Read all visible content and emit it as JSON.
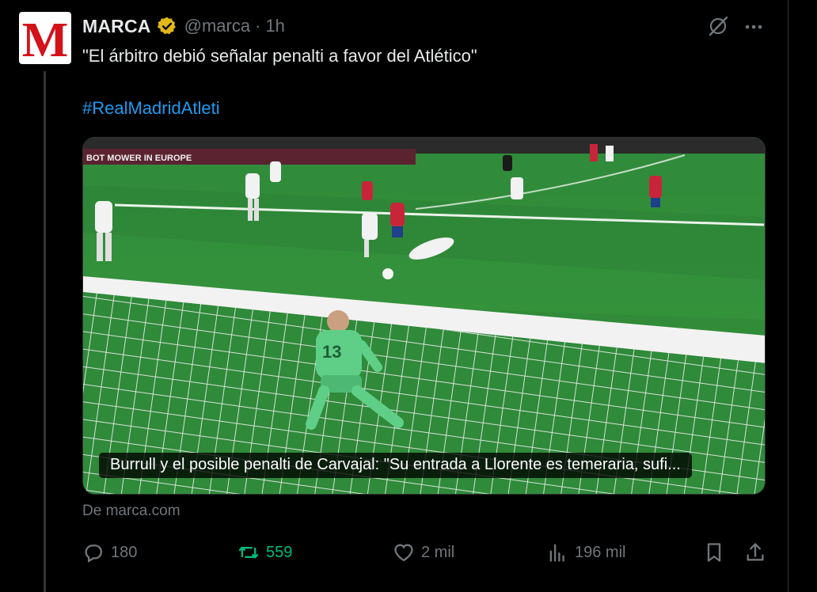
{
  "tweet": {
    "author_name": "MARCA",
    "avatar_letter": "M",
    "handle": "@marca",
    "separator": "·",
    "time": "1h",
    "text": "\"El árbitro debió señalar penalti a favor del Atlético\"",
    "hashtag": "#RealMadridAtleti"
  },
  "media": {
    "caption": "Burrull y el posible penalti de Carvajal: \"Su entrada a Llorente es temeraria, sufi...",
    "jersey_number": "13",
    "board_text": "BOT MOWER IN EUROPE"
  },
  "source": "De marca.com",
  "actions": {
    "replies": "180",
    "retweets": "559",
    "likes": "2 mil",
    "views": "196 mil"
  },
  "colors": {
    "background": "#000000",
    "text": "#e7e9ea",
    "muted": "#71767b",
    "link": "#1d9bf0",
    "retweet": "#00ba7c",
    "verified": "#e2b719",
    "brand": "#d4121a"
  },
  "icons": [
    "verified-badge-icon",
    "grok-icon",
    "more-icon",
    "reply-icon",
    "retweet-icon",
    "like-icon",
    "views-icon",
    "bookmark-icon",
    "share-icon"
  ]
}
